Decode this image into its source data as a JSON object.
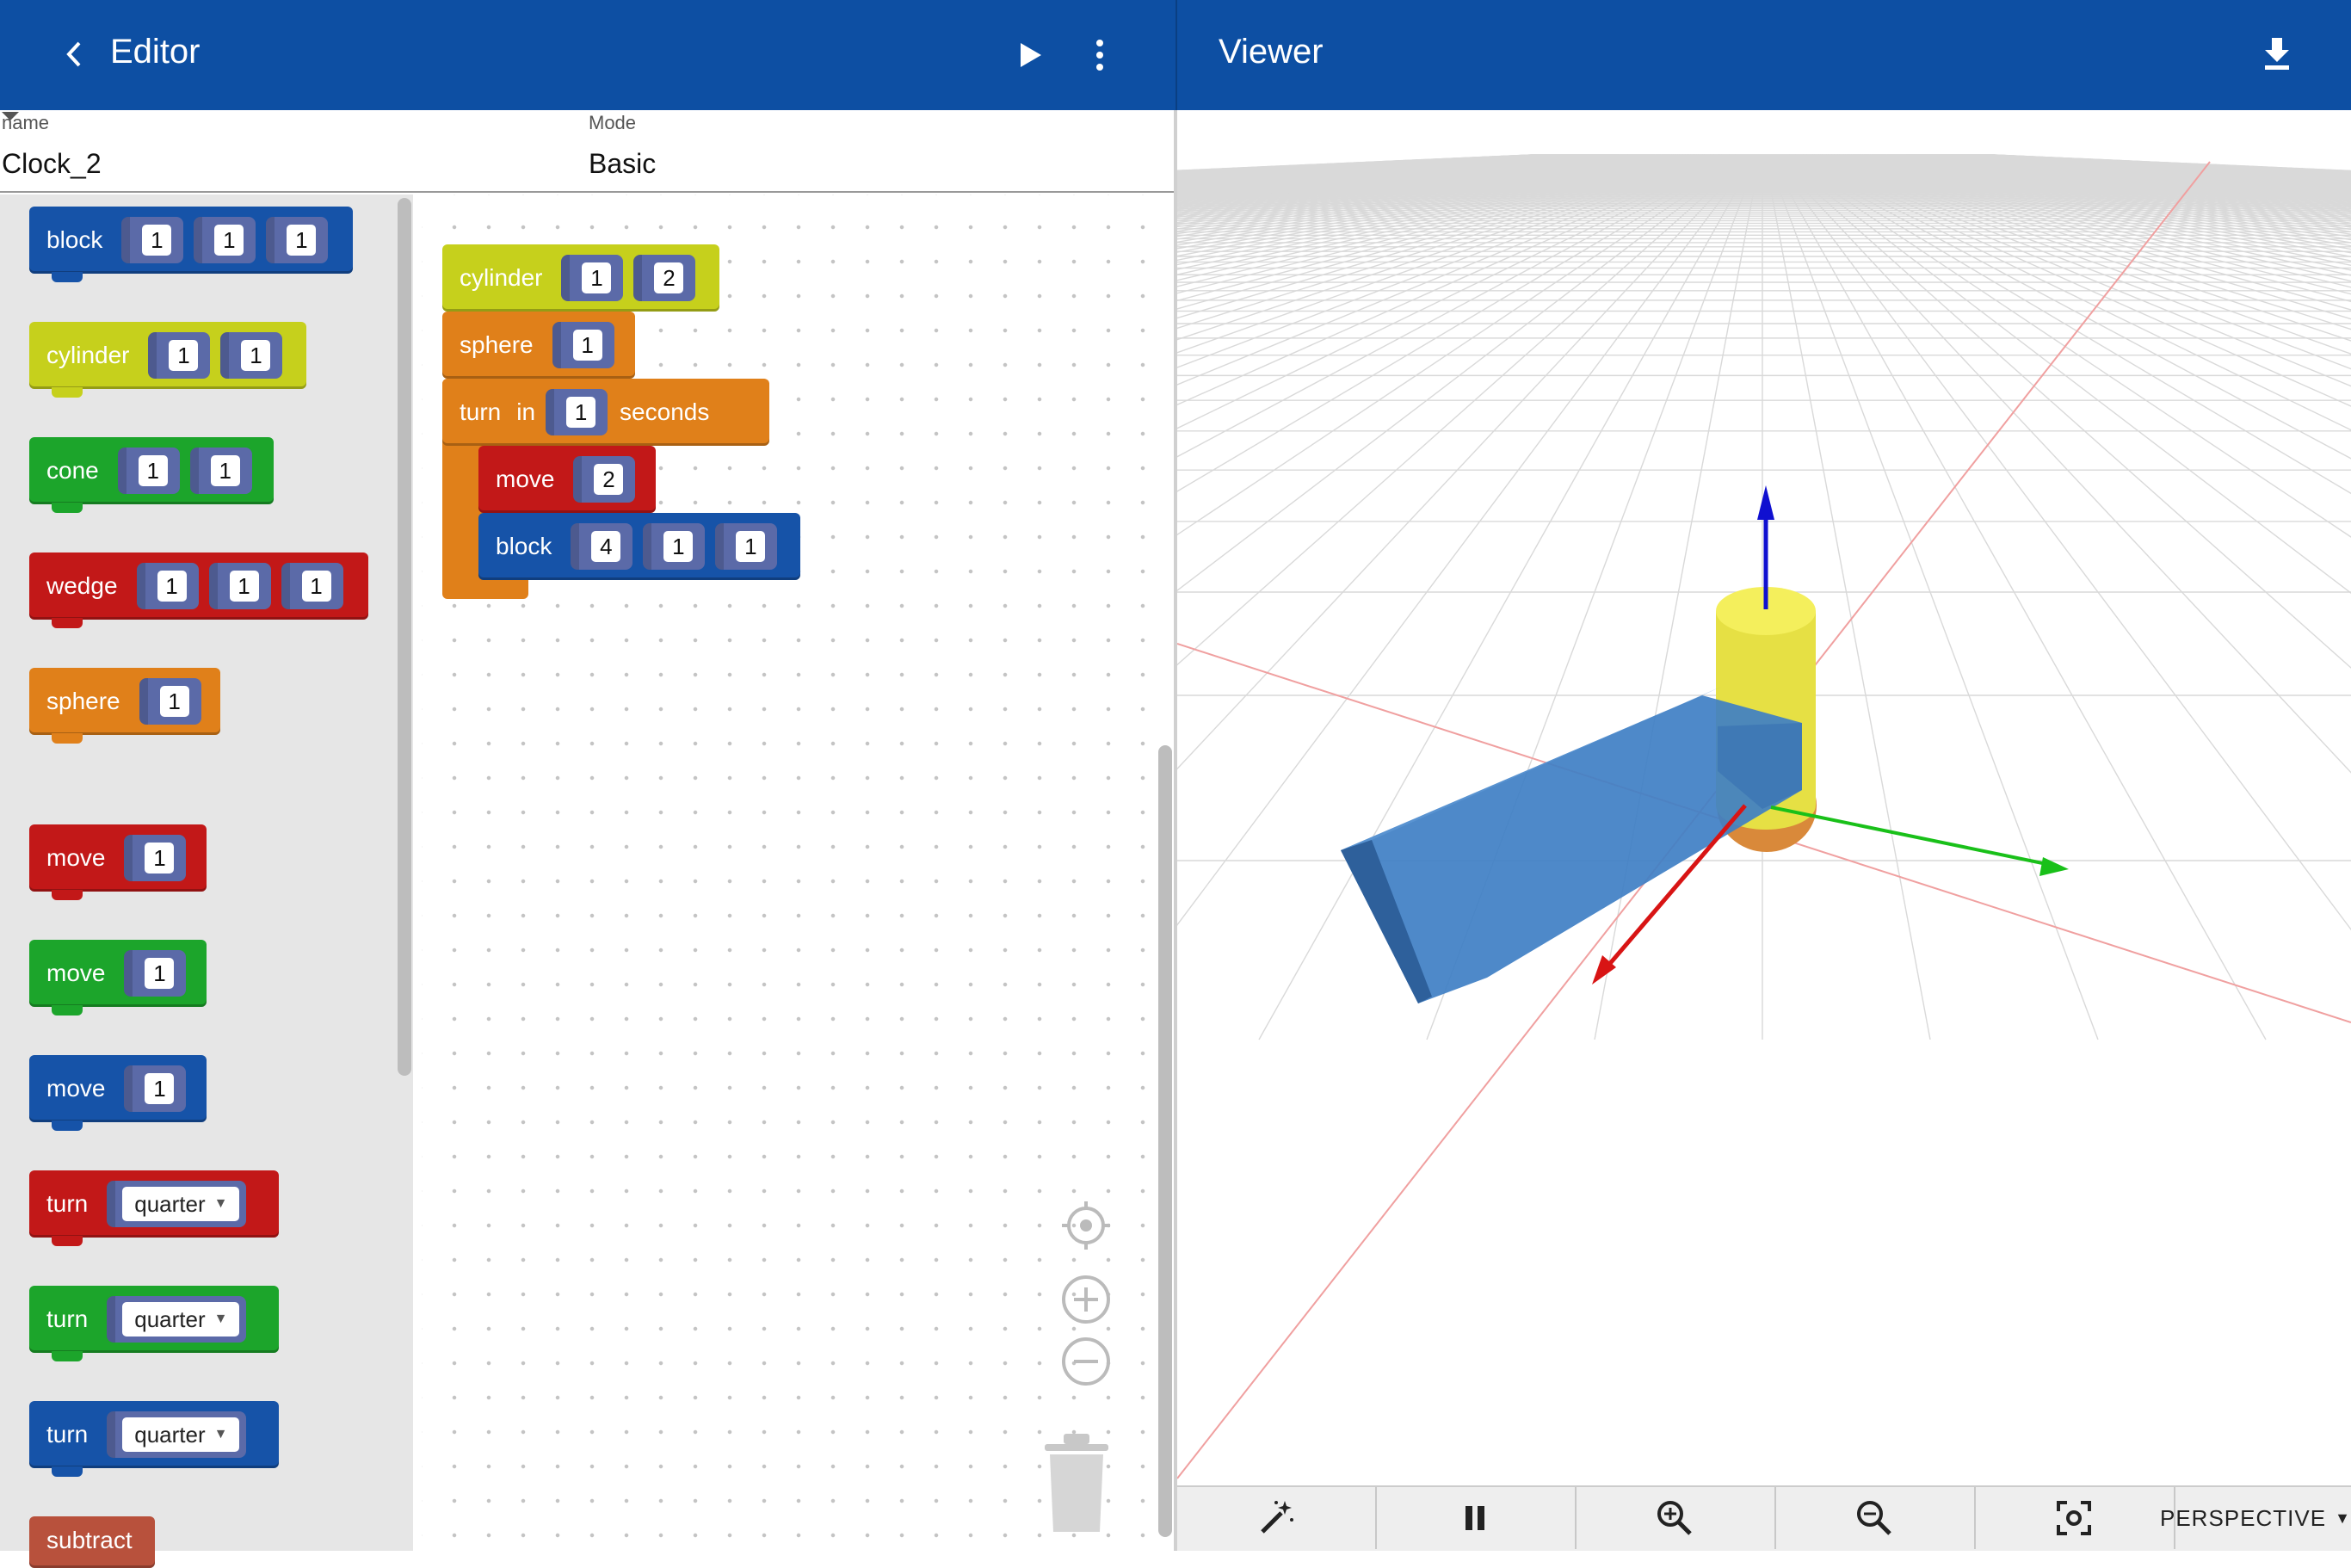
{
  "editor": {
    "title": "Editor",
    "name_label": "name",
    "name_value": "Clock_2",
    "mode_label": "Mode",
    "mode_value": "Basic"
  },
  "viewer": {
    "title": "Viewer",
    "camera_mode": "PERSPECTIVE"
  },
  "toolbox": {
    "block_label": "block",
    "cylinder_label": "cylinder",
    "cone_label": "cone",
    "wedge_label": "wedge",
    "sphere_label": "sphere",
    "move_label": "move",
    "turn_label": "turn",
    "turn_option": "quarter",
    "subtract_label": "subtract",
    "default_value": "1"
  },
  "workspace": {
    "cylinder_label": "cylinder",
    "cylinder_v1": "1",
    "cylinder_v2": "2",
    "sphere_label": "sphere",
    "sphere_v1": "1",
    "turn_label": "turn",
    "in_label": "in",
    "turn_v1": "1",
    "seconds_label": "seconds",
    "move_label": "move",
    "move_v1": "2",
    "block_label": "block",
    "block_v1": "4",
    "block_v2": "1",
    "block_v3": "1"
  },
  "colors": {
    "appbar": "#0d4fa3",
    "block_blue": "#1653a8",
    "block_yellow": "#c6d01c",
    "block_green": "#1ca52b",
    "block_red": "#c21818",
    "block_orange": "#e0801a"
  }
}
